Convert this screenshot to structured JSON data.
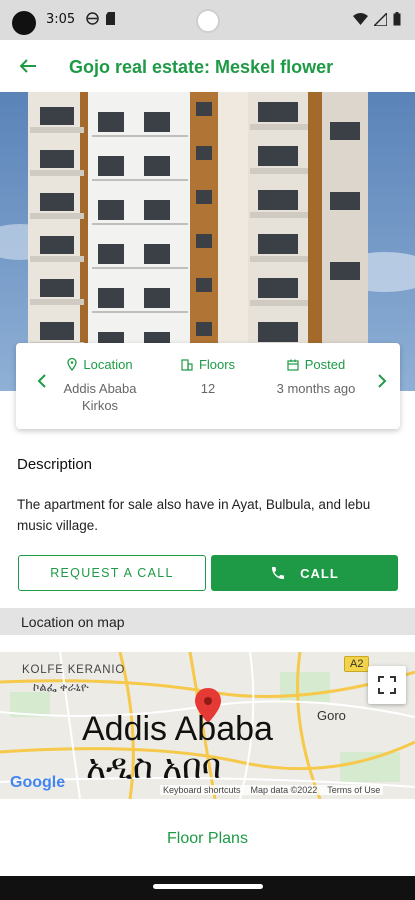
{
  "status_bar": {
    "time": "3:05"
  },
  "app_bar": {
    "title": "Gojo real estate: Meskel flower"
  },
  "info_card": {
    "location_label": "Location",
    "location_value_line1": "Addis Ababa",
    "location_value_line2": "Kirkos",
    "floors_label": "Floors",
    "floors_value": "12",
    "posted_label": "Posted",
    "posted_value": "3 months ago"
  },
  "description": {
    "title": "Description",
    "text": "The apartment for sale also have in Ayat, Bulbula, and lebu music village."
  },
  "actions": {
    "request_call_label": "REQUEST A CALL",
    "call_label": "CALL"
  },
  "map_section": {
    "label": "Location on map",
    "kolfe": "KOLFE KERANIO",
    "kolfe_am": "ኮልፌ ቀራኒዮ",
    "goro": "Goro",
    "city_en": "Addis Ababa",
    "city_am": "አዲስ አበባ",
    "road_badge": "A2",
    "google": "Google",
    "footer_shortcuts": "Keyboard shortcuts",
    "footer_data": "Map data ©2022",
    "footer_terms": "Terms of Use"
  },
  "floor_plans": {
    "label": "Floor Plans"
  },
  "colors": {
    "accent": "#1e9a46",
    "marker": "#e53935"
  }
}
